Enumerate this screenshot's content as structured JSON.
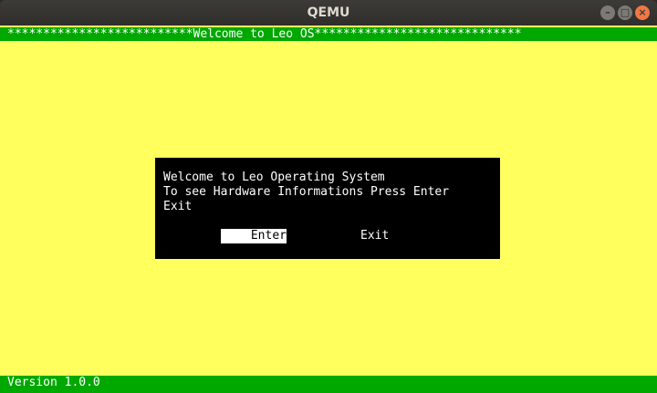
{
  "window": {
    "title": "QEMU",
    "buttons": {
      "minimize": "–",
      "maximize": "□",
      "close": "×"
    }
  },
  "screen": {
    "header": "**************************Welcome to Leo OS*****************************",
    "dialog": {
      "line1": "Welcome to Leo Operating System",
      "line2": "To see Hardware Informations Press Enter",
      "line3": "Exit",
      "enter_label": "Enter",
      "exit_label": "Exit"
    },
    "footer": "Version 1.0.0"
  },
  "colors": {
    "background": "#ffff5e",
    "bars": "#00a800",
    "dialog": "#000000",
    "selected": "#ffffff"
  }
}
